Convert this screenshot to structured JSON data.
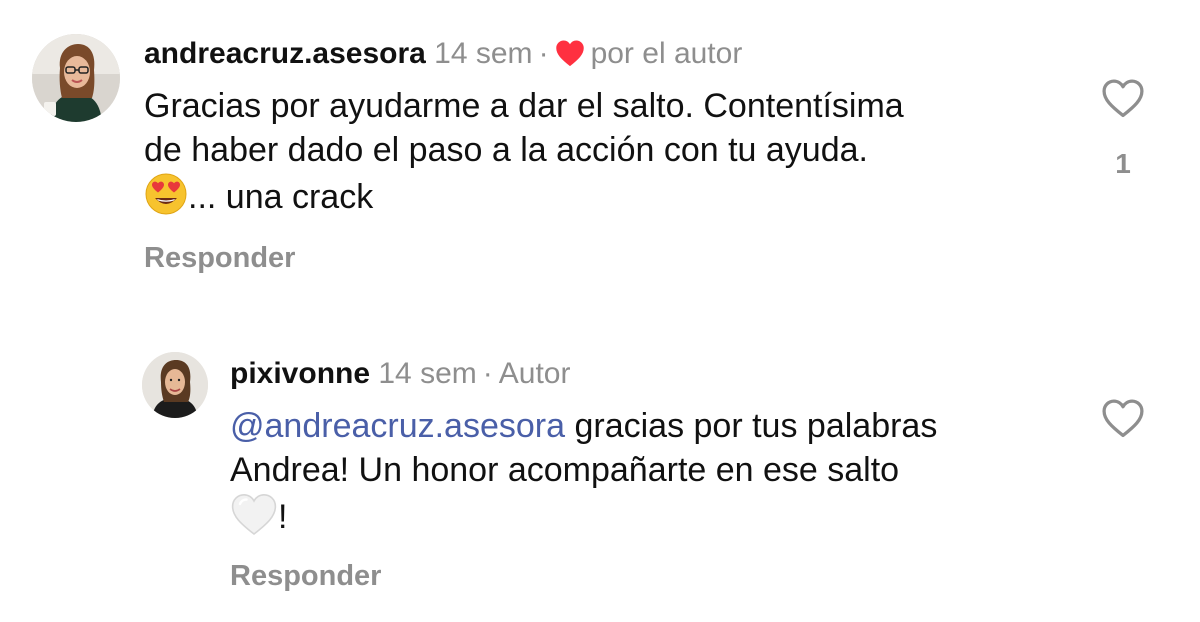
{
  "comments": [
    {
      "username": "andreacruz.asesora",
      "time": "14 sem",
      "liked_by_author_label": "por el autor",
      "text_line1": "Gracias por ayudarme a dar el salto.  Contentísima",
      "text_line2": "de haber dado el paso a la acción con tu ayuda.",
      "text_line3": "... una crack",
      "emoji": "heart-eyes-emoji",
      "reply_label": "Responder",
      "like_count": "1",
      "heart_color": "#ff3040"
    },
    {
      "username": "pixivonne",
      "time": "14 sem",
      "author_badge": "Autor",
      "mention": "@andreacruz.asesora",
      "text_line1_rest": " gracias por tus palabras",
      "text_line2": "Andrea! Un honor acompañarte en ese salto",
      "text_line3": "!",
      "emoji": "white-heart-emoji",
      "reply_label": "Responder"
    }
  ],
  "colors": {
    "meta_gray": "#8e8e8e",
    "mention_blue": "#4a5fa8",
    "text": "#111111"
  }
}
